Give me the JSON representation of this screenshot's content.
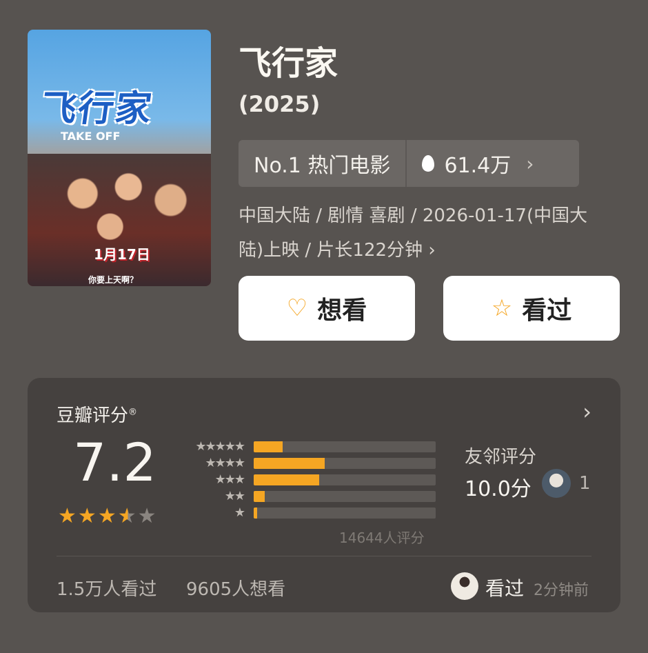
{
  "poster": {
    "logo": "飞行家",
    "subtitle": "TAKE OFF",
    "date_text": "1月17日",
    "tagline": "你要上天啊？"
  },
  "movie": {
    "title": "飞行家",
    "year": "(2025)"
  },
  "rank": {
    "label": "No.1 热门电影",
    "heat": "61.4万"
  },
  "meta": {
    "line": "中国大陆 / 剧情 喜剧 / 2026-01-17(中国大陆)上映 / 片长122分钟"
  },
  "buttons": {
    "want_label": "想看",
    "seen_label": "看过"
  },
  "rating": {
    "heading": "豆瓣评分",
    "reg_mark": "®",
    "score": "7.2",
    "stars": 3.5,
    "distribution": [
      {
        "stars": "★★★★★",
        "fraction": 0.16
      },
      {
        "stars": "★★★★",
        "fraction": 0.39
      },
      {
        "stars": "★★★",
        "fraction": 0.36
      },
      {
        "stars": "★★",
        "fraction": 0.06
      },
      {
        "stars": "★",
        "fraction": 0.02
      }
    ],
    "count_text": "14644人评分",
    "friend_label": "友邻评分",
    "friend_score": "10.0分",
    "friend_count": "1",
    "seen_count": "1.5万人看过",
    "want_count": "9605人想看",
    "activity_label": "看过",
    "activity_time": "2分钟前"
  },
  "colors": {
    "background": "#575350",
    "card": "#45413f",
    "accent": "#f5a623"
  }
}
